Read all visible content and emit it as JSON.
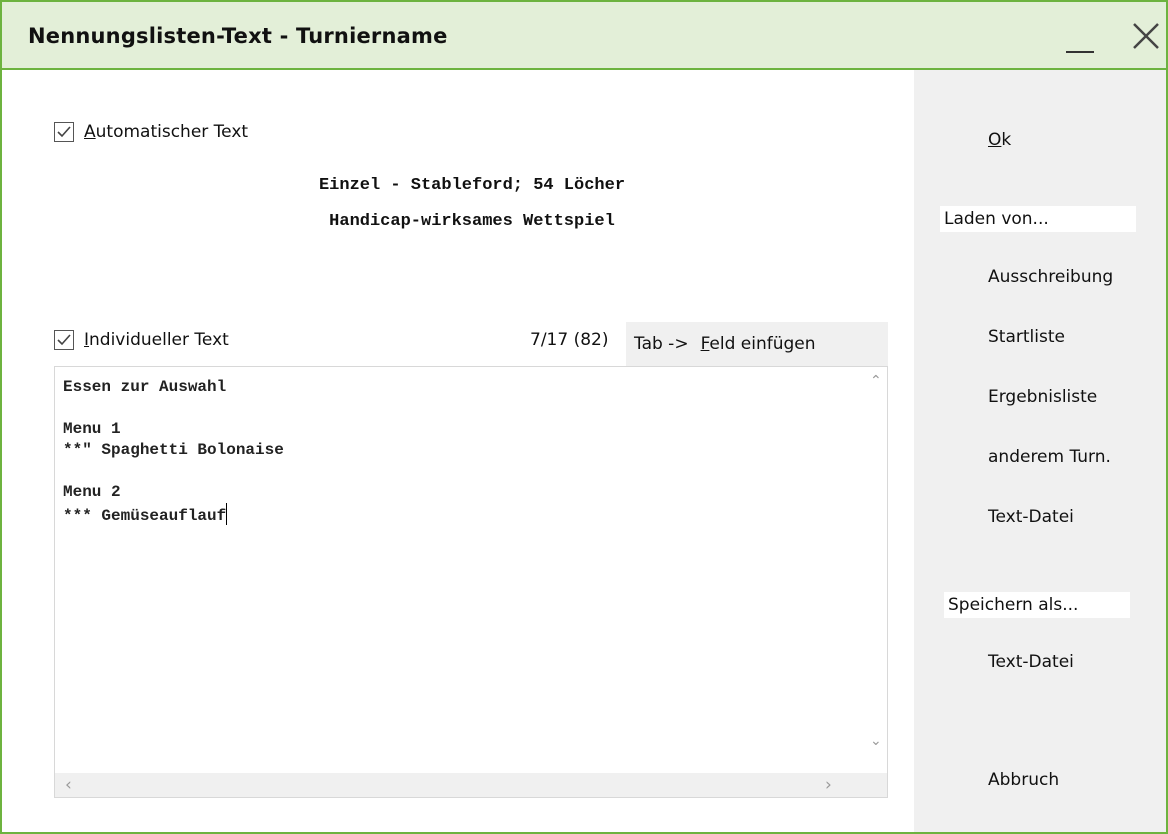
{
  "window": {
    "title": "Nennungslisten-Text - Turniername",
    "minimize_label": "_",
    "close_label": "X"
  },
  "auto": {
    "checkbox_label_u": "A",
    "checkbox_label_rest": "utomatischer Text",
    "checked": true,
    "line1": "Einzel - Stableford; 54 Löcher",
    "line2": "Handicap-wirksames Wettspiel"
  },
  "individual": {
    "checkbox_label_u": "I",
    "checkbox_label_rest": "ndividueller Text",
    "checked": true,
    "counter": "7/17 (82)",
    "insert_button_prefix": "Tab ->",
    "insert_button_u": "F",
    "insert_button_rest": "eld einfügen",
    "editor_text": "Essen zur Auswahl\n\nMenu 1\n**\" Spaghetti Bolonaise\n\nMenu 2\n*** Gemüseauflauf"
  },
  "sidebar": {
    "ok_u": "O",
    "ok_rest": "k",
    "load_heading": "Laden von...",
    "load_items": [
      "Ausschreibung",
      "Startliste",
      "Ergebnisliste",
      "anderem Turn.",
      "Text-Datei"
    ],
    "save_heading": "Speichern als...",
    "save_items": [
      "Text-Datei"
    ],
    "cancel": "Abbruch"
  }
}
